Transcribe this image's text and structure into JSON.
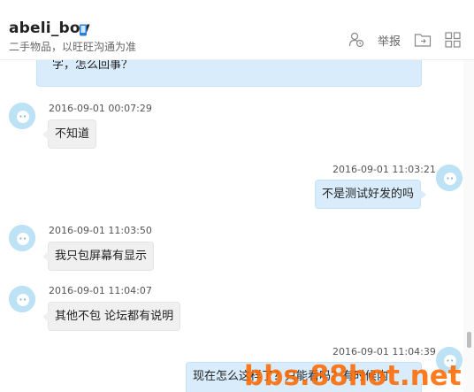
{
  "header": {
    "title": "abeli_boy",
    "subtitle": "二手物品，以旺旺沟通为准",
    "report_label": "举报",
    "icons": [
      "user-settings-icon",
      "folder-icon",
      "grid-icon",
      "phone-icon"
    ]
  },
  "messages": [
    {
      "side": "self",
      "text": "字，怎么回事？"
    },
    {
      "side": "other",
      "time": "2016-09-01 00:07:29",
      "text": "不知道"
    },
    {
      "side": "self",
      "time": "2016-09-01 11:03:21",
      "text": "不是测试好发的吗"
    },
    {
      "side": "other",
      "time": "2016-09-01 11:03:50",
      "text": "我只包屏幕有显示"
    },
    {
      "side": "other",
      "time": "2016-09-01 11:04:07",
      "text": "其他不包 论坛都有说明"
    },
    {
      "side": "self",
      "time": "2016-09-01 11:04:39",
      "text": "现在怎么这样了？只能看吗？有时候内"
    }
  ],
  "watermark": "bbs.88hot.net",
  "colors": {
    "self_bubble": "#d8ecfc",
    "other_bubble": "#f0f0f0",
    "avatar": "#bde2f5",
    "watermark": "#ff6a00"
  }
}
